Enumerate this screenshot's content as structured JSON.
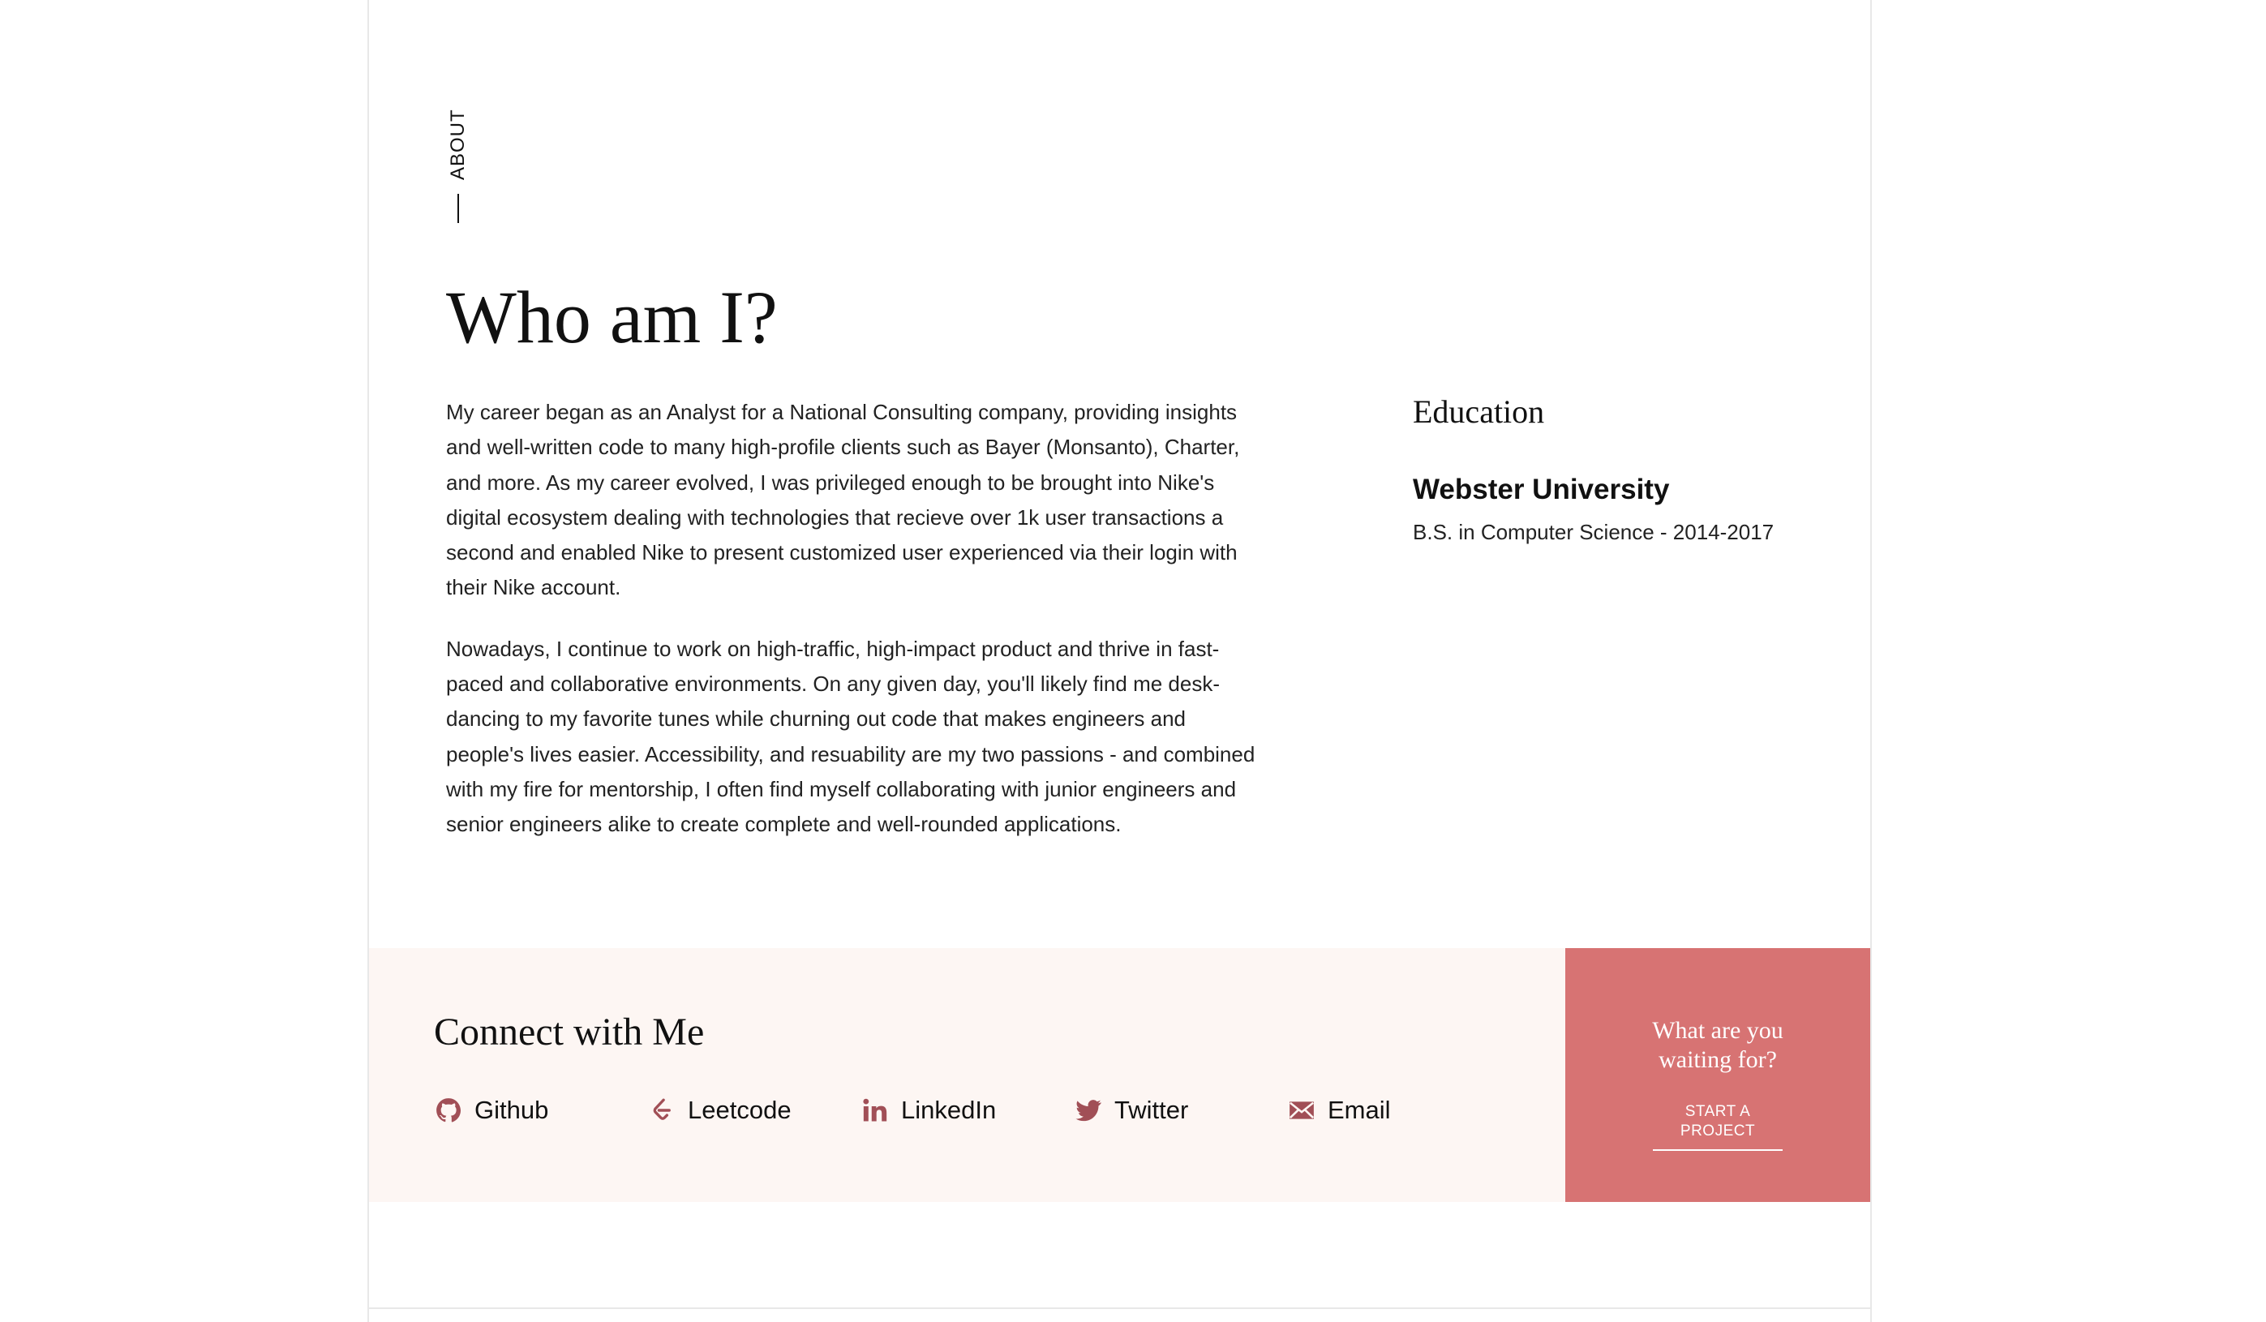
{
  "section_label": "ABOUT",
  "title": "Who am I?",
  "bio": {
    "paragraphs": [
      "My career began as an Analyst for a National Consulting company, providing insights and well-written code to many high-profile clients such as Bayer (Monsanto), Charter, and more. As my career evolved, I was privileged enough to be brought into Nike's digital ecosystem dealing with technologies that recieve over 1k user transactions a second and enabled Nike to present customized user experienced via their login with their Nike account.",
      "Nowadays, I continue to work on high-traffic, high-impact product and thrive in fast-paced and collaborative environments. On any given day, you'll likely find me desk-dancing to my favorite tunes while churning out code that makes engineers and people's lives easier. Accessibility, and resuability are my two passions - and combined with my fire for mentorship, I often find myself collaborating with junior engineers and senior engineers alike to create complete and well-rounded applications."
    ]
  },
  "education": {
    "heading": "Education",
    "school": "Webster University",
    "degree": "B.S. in Computer Science - 2014-2017"
  },
  "connect": {
    "heading": "Connect with Me",
    "links": [
      {
        "label": "Github",
        "icon": "github-icon"
      },
      {
        "label": "Leetcode",
        "icon": "leetcode-icon"
      },
      {
        "label": "LinkedIn",
        "icon": "linkedin-icon"
      },
      {
        "label": "Twitter",
        "icon": "twitter-icon"
      },
      {
        "label": "Email",
        "icon": "email-icon"
      }
    ]
  },
  "cta": {
    "line1": "What are you",
    "line2": "waiting for?",
    "button_label": "START A PROJECT"
  },
  "colors": {
    "accent": "#d77373",
    "icon": "#a14f56",
    "connect_bg": "#fdf6f3",
    "text": "#111111"
  }
}
